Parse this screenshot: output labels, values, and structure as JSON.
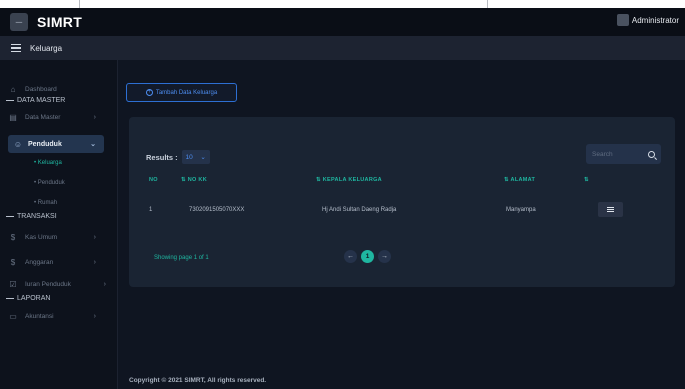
{
  "header": {
    "app_title": "SIMRT",
    "user_label": "Administrator"
  },
  "subheader": {
    "title": "Keluarga"
  },
  "sidebar": {
    "dashboard": "Dashboard",
    "section_master": "DATA MASTER",
    "data_master": "Data Master",
    "penduduk": "Penduduk",
    "sub_keluarga": "• Keluarga",
    "sub_penduduk": "• Penduduk",
    "sub_rumah": "• Rumah",
    "section_transaksi": "TRANSAKSI",
    "kas_umum": "Kas Umum",
    "anggaran": "Anggaran",
    "iuran": "Iuran Penduduk",
    "section_laporan": "LAPORAN",
    "akuntansi": "Akuntansi"
  },
  "main": {
    "add_button": "Tambah Data Keluarga",
    "results_label": "Results :",
    "results_value": "10",
    "search_placeholder": "Search",
    "columns": {
      "no": "NO",
      "no_kk": "NO KK",
      "kepala": "KEPALA KELUARGA",
      "alamat": "ALAMAT"
    },
    "rows": [
      {
        "no": "1",
        "no_kk": "7302091505070XXX",
        "kepala": "Hj Andi Sultan Daeng Radja",
        "alamat": "Manyampa"
      }
    ],
    "showing": "Showing page 1 of 1",
    "current_page": "1"
  },
  "footer": {
    "text": "Copyright © 2021 SIMRT, All rights reserved."
  },
  "colors": {
    "accent": "#1fb6a0",
    "primary": "#2d6fd3",
    "background": "#0f1521",
    "card": "#1a2433"
  }
}
